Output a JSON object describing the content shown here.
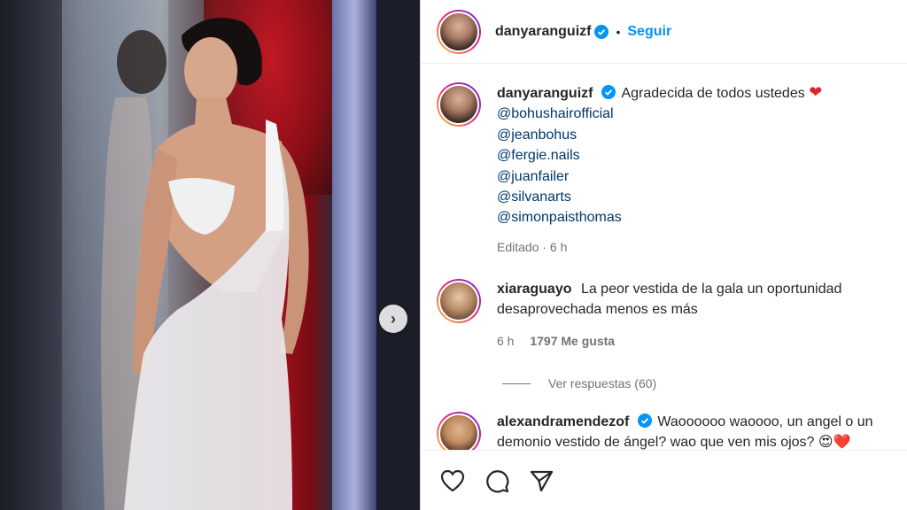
{
  "post": {
    "author": "danyaranguizf",
    "follow_label": "Seguir",
    "separator": "•"
  },
  "caption": {
    "author": "danyaranguizf",
    "text": "Agradecida de todos ustedes",
    "emoji": "❤",
    "mentions": [
      "@bohushairofficial",
      "@jeanbohus",
      "@fergie.nails",
      "@juanfailer",
      "@silvanarts",
      "@simonpaisthomas"
    ],
    "meta": "Editado · 6 h"
  },
  "comments": [
    {
      "author": "xiaraguayo",
      "text": "La peor vestida de la gala un oportunidad desaprovechada menos es más",
      "time": "6 h",
      "likes": "1797 Me gusta"
    },
    {
      "author": "alexandramendezof",
      "text": "Waoooooo waoooo, un angel o un demonio vestido de ángel? wao que ven mis ojos? 😍❤️"
    }
  ],
  "replies_label": "Ver respuestas (60)",
  "colors": {
    "link": "#00376b",
    "follow": "#0095f6",
    "heart": "#e0242f",
    "verified": "#0095f6"
  },
  "icons": [
    "heart-icon",
    "comment-icon",
    "share-icon",
    "chevron-right-icon",
    "verified-icon"
  ]
}
